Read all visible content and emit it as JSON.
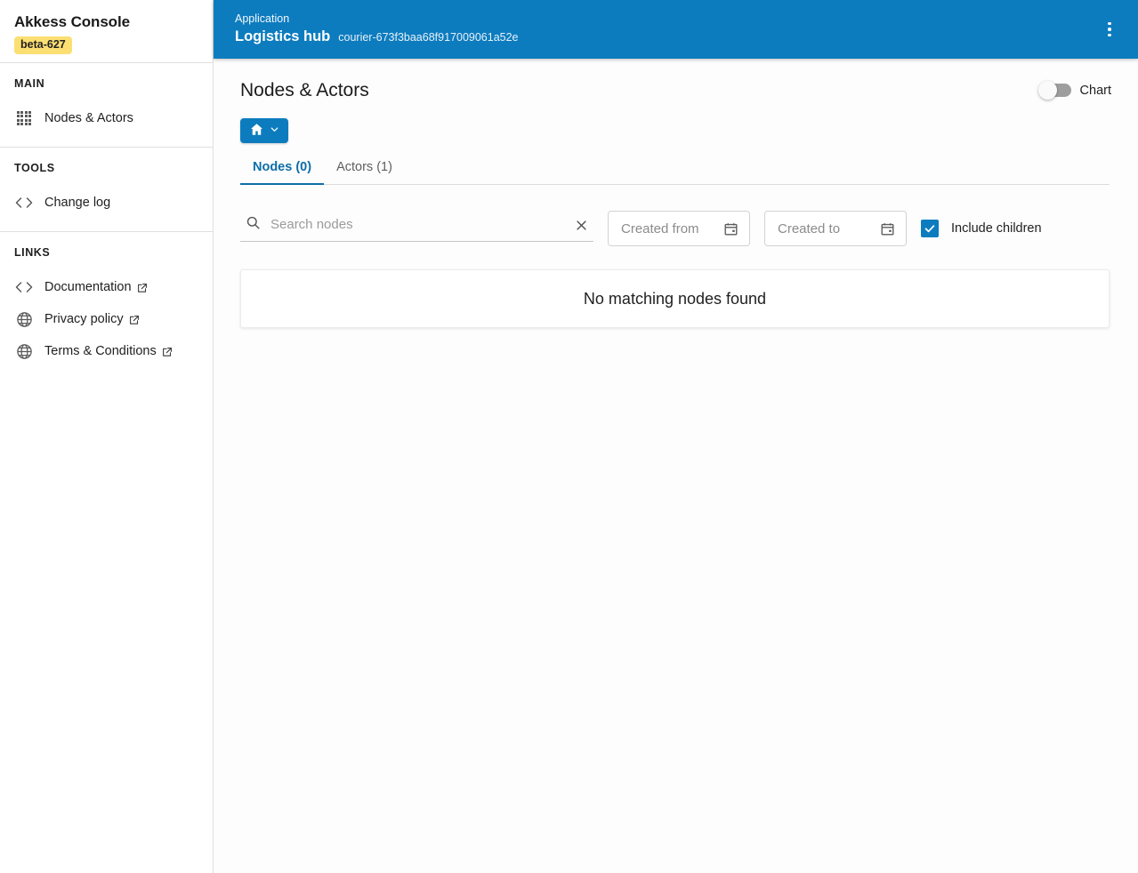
{
  "sidebar": {
    "brand": {
      "name": "Akkess Console",
      "badge": "beta-627"
    },
    "sections": [
      {
        "heading": "MAIN",
        "items": [
          {
            "label": "Nodes & Actors",
            "icon": "grid-icon",
            "external": false
          }
        ]
      },
      {
        "heading": "TOOLS",
        "items": [
          {
            "label": "Change log",
            "icon": "code-icon",
            "external": false
          }
        ]
      },
      {
        "heading": "LINKS",
        "items": [
          {
            "label": "Documentation",
            "icon": "code-icon",
            "external": true
          },
          {
            "label": "Privacy policy",
            "icon": "globe-icon",
            "external": true
          },
          {
            "label": "Terms & Conditions",
            "icon": "globe-icon",
            "external": true
          }
        ]
      }
    ]
  },
  "topbar": {
    "eyebrow": "Application",
    "title": "Logistics hub",
    "id": "courier-673f3baa68f917009061a52e",
    "menu_icon": "kebab-menu-icon",
    "background": "#0d7cbf"
  },
  "page": {
    "title": "Nodes & Actors",
    "chart_toggle": {
      "label": "Chart",
      "enabled": false
    },
    "breadcrumb": {
      "icon": "home-icon",
      "caret": "chevron-down-icon"
    }
  },
  "tabs": [
    {
      "label": "Nodes (0)",
      "active": true
    },
    {
      "label": "Actors (1)",
      "active": false
    }
  ],
  "filters": {
    "search": {
      "placeholder": "Search nodes",
      "value": "",
      "icon": "search-icon",
      "clear_icon": "close-icon"
    },
    "created_from": {
      "placeholder": "Created from",
      "value": "",
      "icon": "calendar-icon"
    },
    "created_to": {
      "placeholder": "Created to",
      "value": "",
      "icon": "calendar-icon"
    },
    "include_children": {
      "label": "Include children",
      "checked": true
    }
  },
  "results": {
    "empty_message": "No matching nodes found"
  },
  "colors": {
    "accent": "#0d7cbf",
    "tab_active": "#0d6ea8",
    "badge": "#fbdf72"
  }
}
